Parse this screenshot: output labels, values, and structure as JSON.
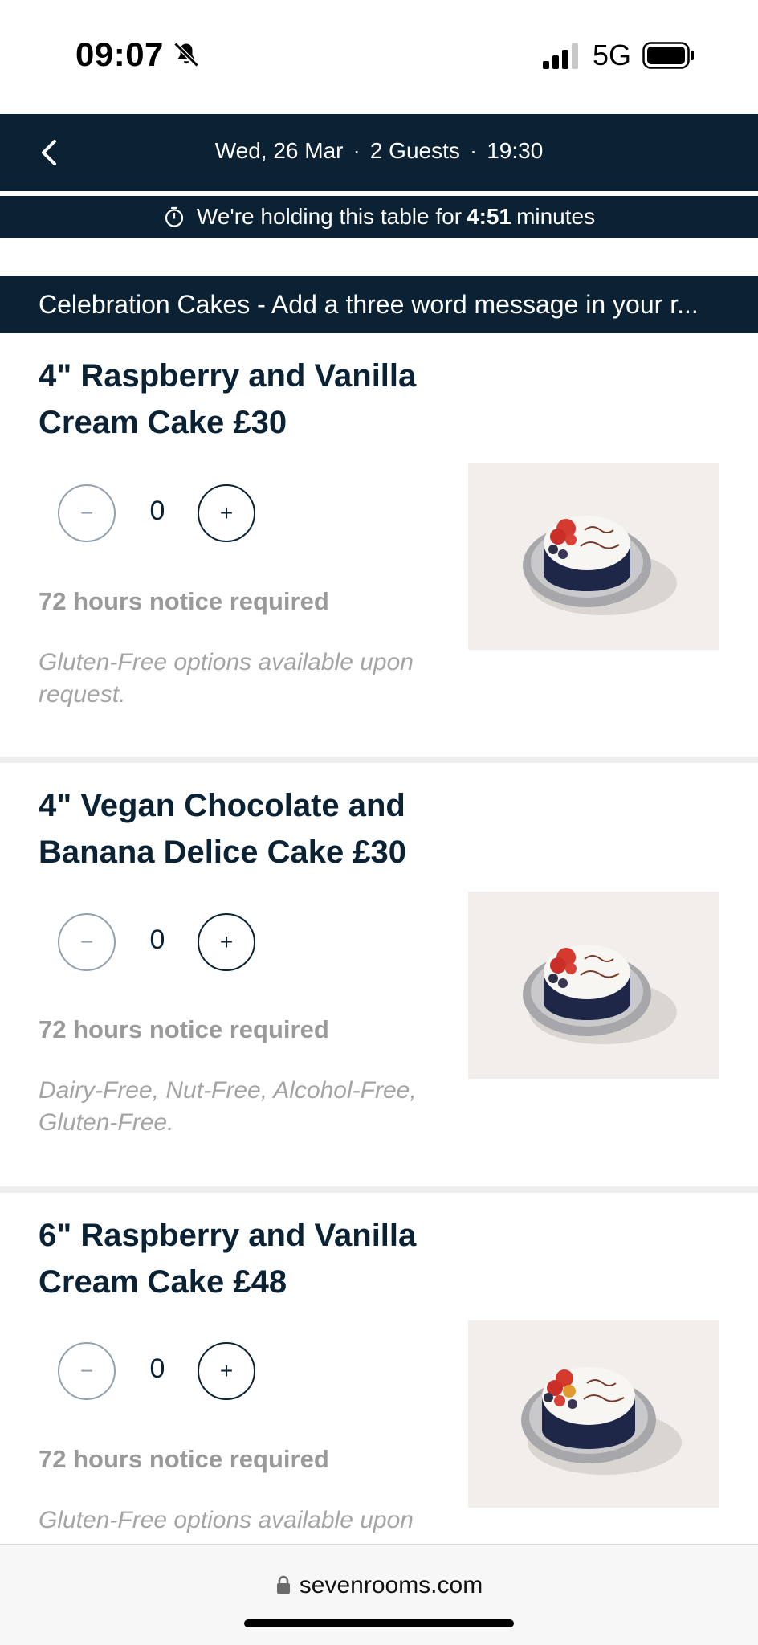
{
  "status_bar": {
    "time": "09:07",
    "network": "5G"
  },
  "booking": {
    "date": "Wed, 26 Mar",
    "guests": "2 Guests",
    "time": "19:30",
    "hold_prefix": "We're holding this table for",
    "hold_time": "4:51",
    "hold_suffix": "minutes"
  },
  "category": {
    "title": "Celebration Cakes - Add a three word message in your r..."
  },
  "products": [
    {
      "title": "4\" Raspberry and Vanilla Cream Cake £30",
      "quantity": "0",
      "minus_label": "−",
      "plus_label": "+",
      "notice": "72 hours notice required",
      "description": "Gluten-Free options available upon request.",
      "image_icon": "cake-happy-birthday-image"
    },
    {
      "title": "4\" Vegan Chocolate and Banana Delice Cake £30",
      "quantity": "0",
      "minus_label": "−",
      "plus_label": "+",
      "notice": "72 hours notice required",
      "description": "Dairy-Free, Nut-Free, Alcohol-Free, Gluten-Free.",
      "image_icon": "cake-happy-birthday-image"
    },
    {
      "title": "6\" Raspberry and Vanilla Cream Cake £48",
      "quantity": "0",
      "minus_label": "−",
      "plus_label": "+",
      "notice": "72 hours notice required",
      "description": "Gluten-Free options available upon",
      "image_icon": "cake-happy-anniversary-image"
    }
  ],
  "browser": {
    "url": "sevenrooms.com"
  },
  "colors": {
    "navy": "#0b2235",
    "muted": "#9a9a9a",
    "divider": "#eeeeee"
  }
}
